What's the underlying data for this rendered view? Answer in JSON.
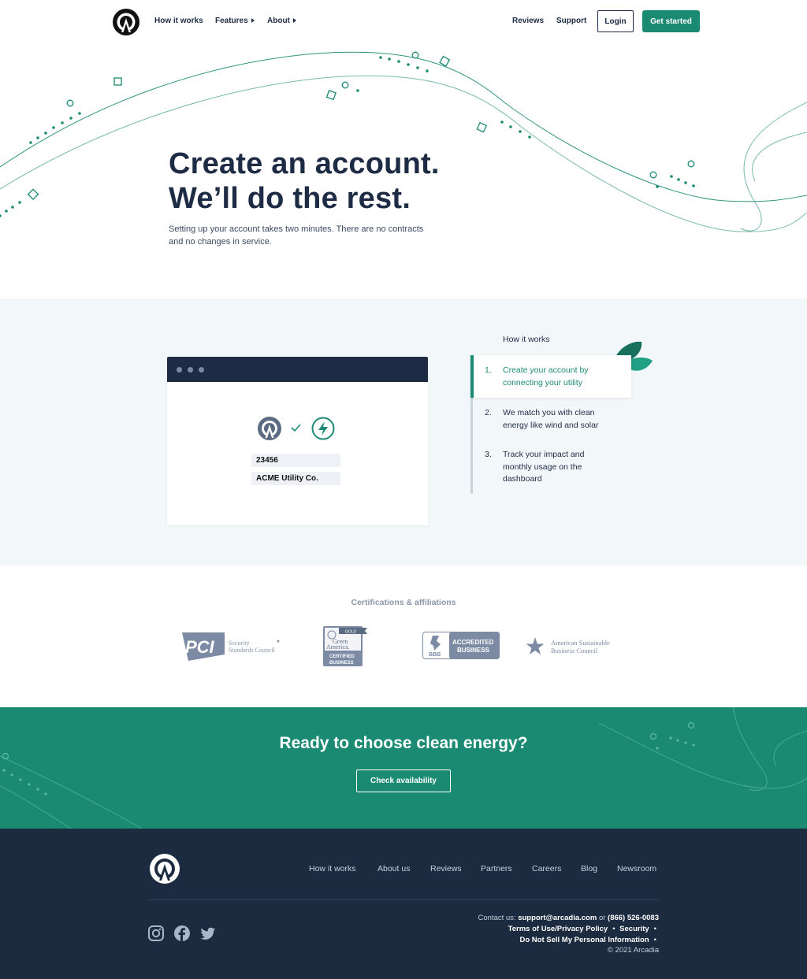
{
  "header": {
    "nav": [
      {
        "label": "How it works"
      },
      {
        "label": "Features"
      },
      {
        "label": "About"
      }
    ],
    "right_nav": [
      {
        "label": "Reviews"
      },
      {
        "label": "Support"
      }
    ],
    "login_label": "Login",
    "get_started_label": "Get started"
  },
  "hero": {
    "title_line1": "Create an account.",
    "title_line2": "We’ll do the rest.",
    "subtitle": "Setting up your account takes two minutes. There are no contracts and no changes in service."
  },
  "how_it_works": {
    "label": "How it works",
    "browser": {
      "account_number": "23456",
      "utility_name": "ACME Utility Co."
    },
    "steps": [
      {
        "num": "1.",
        "text": "Create your account by connecting your utility"
      },
      {
        "num": "2.",
        "text": "We match you with clean energy like wind and solar"
      },
      {
        "num": "3.",
        "text": "Track your impact and monthly usage on the dashboard"
      }
    ]
  },
  "certifications": {
    "title": "Certifications & affiliations",
    "pci": {
      "mark": "PCI",
      "line1": "Security",
      "line2": "Standards Council"
    },
    "green_america": {
      "ribbon": "GOLD",
      "line1": "Green",
      "line2": "America.",
      "badge1": "CERTIFIED",
      "badge2": "BUSINESS"
    },
    "bbb": {
      "mark": "BBB",
      "line1": "ACCREDITED",
      "line2": "BUSINESS"
    },
    "asbc": {
      "line1": "American Sustainable",
      "line2": "Business Council"
    }
  },
  "cta": {
    "title": "Ready to choose clean energy?",
    "button_label": "Check availability"
  },
  "footer": {
    "nav": [
      "How it works",
      "About us",
      "Reviews",
      "Partners",
      "Careers",
      "Blog",
      "Newsroom"
    ],
    "contact_prefix": "Contact us:",
    "email": "support@arcadia.com",
    "or": "or",
    "phone": "(866) 526-0083",
    "terms": "Terms of Use/Privacy Policy",
    "security": "Security",
    "do_not_sell": "Do Not Sell My Personal Information",
    "copyright": "© 2021 Arcadia",
    "social_icons": [
      "instagram-icon",
      "facebook-icon",
      "twitter-icon"
    ]
  },
  "colors": {
    "navy": "#1d2b45",
    "green": "#1a8a72",
    "footer_bg": "#1d2b40",
    "section_bg": "#f2f7fa"
  }
}
